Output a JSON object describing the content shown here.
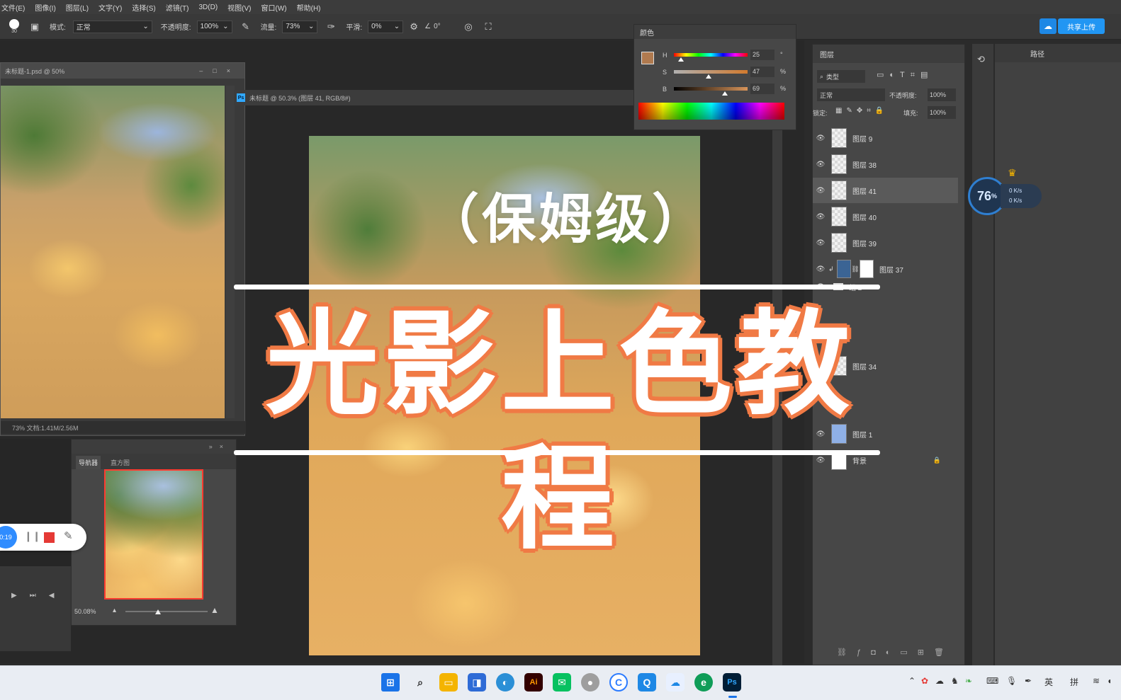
{
  "menu": [
    "文件(E)",
    "图像(I)",
    "图层(L)",
    "文字(Y)",
    "选择(S)",
    "滤镜(T)",
    "3D(D)",
    "视图(V)",
    "窗口(W)",
    "帮助(H)"
  ],
  "options": {
    "brush_size": "30",
    "mode_label": "模式:",
    "mode_value": "正常",
    "opacity_label": "不透明度:",
    "opacity_value": "100%",
    "flow_label": "流量:",
    "flow_value": "73%",
    "smooth_label": "平滑:",
    "smooth_value": "0%",
    "angle_value": "0°",
    "share_label": "共享上传"
  },
  "side_doc": {
    "title": "未标题-1.psd @ 50%",
    "status": "73% 文档:1.41M/2.56M"
  },
  "main_doc": {
    "tab": "未标题 @ 50.3% (图层 41, RGB/8#)"
  },
  "color_panel": {
    "title": "颜色",
    "h": "25",
    "s": "47",
    "b": "69",
    "h_unit": "°",
    "s_unit": "%",
    "b_unit": "%",
    "fg_color": "#b07a4f"
  },
  "navigator": {
    "tab_active": "导航器",
    "tab_other": "直方图",
    "zoom": "50.08%"
  },
  "layers_panel": {
    "tab": "图层",
    "tab2": "路径",
    "filter": "类型",
    "blend": "正常",
    "opacity_label": "不透明度:",
    "opacity_value": "100%",
    "lock_label": "锁定:",
    "fill_label": "填充:",
    "fill_value": "100%",
    "layers": [
      {
        "name": "图层 9"
      },
      {
        "name": "图层 38"
      },
      {
        "name": "图层 41"
      },
      {
        "name": "图层 40"
      },
      {
        "name": "图层 39"
      },
      {
        "name": "图层 37"
      },
      {
        "name": "组 2"
      },
      {
        "name": "图层 34"
      },
      {
        "name": "图层 1"
      },
      {
        "name": "背景"
      }
    ]
  },
  "perf_widget": {
    "percent": "76",
    "unit": "%",
    "up": "0 K/s",
    "down": "0 K/s"
  },
  "recorder": {
    "time": "0:19"
  },
  "overlay": {
    "subtitle": "（保姆级）",
    "title": "光影上色教程"
  },
  "taskbar": {
    "tray_lang": "英",
    "tray_ime": "拼"
  }
}
